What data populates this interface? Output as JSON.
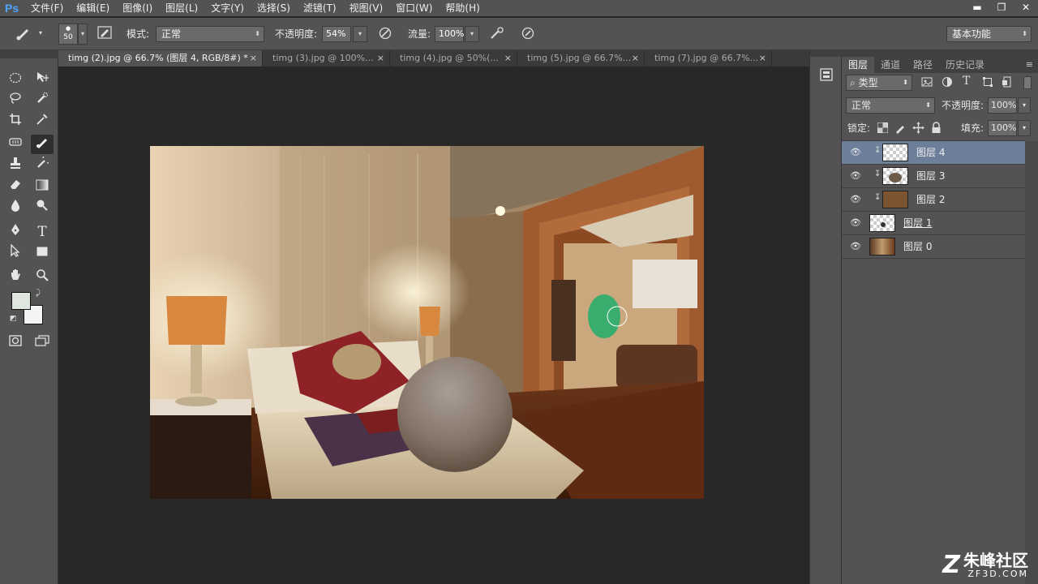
{
  "app": {
    "logo": "Ps"
  },
  "menu": [
    "文件(F)",
    "编辑(E)",
    "图像(I)",
    "图层(L)",
    "文字(Y)",
    "选择(S)",
    "滤镜(T)",
    "视图(V)",
    "窗口(W)",
    "帮助(H)"
  ],
  "window_controls": {
    "minimize": "▬",
    "restore": "❐",
    "close": "✕"
  },
  "options": {
    "brush_size": "50",
    "mode_label": "模式:",
    "mode_value": "正常",
    "opacity_label": "不透明度:",
    "opacity_value": "54%",
    "flow_label": "流量:",
    "flow_value": "100%",
    "workspace": "基本功能"
  },
  "tabs": [
    {
      "label": "timg (2).jpg @ 66.7% (图层 4, RGB/8#) *",
      "close": "×"
    },
    {
      "label": "timg (3).jpg @ 100%...",
      "close": "×"
    },
    {
      "label": "timg (4).jpg @ 50%(...",
      "close": "×"
    },
    {
      "label": "timg (5).jpg @ 66.7%...",
      "close": "×"
    },
    {
      "label": "timg (7).jpg @ 66.7%...",
      "close": "×"
    }
  ],
  "tools": {
    "type_glyph": "T",
    "fg_color": "#dfe6e0",
    "bg_color": "#f4f4f4"
  },
  "layers_panel": {
    "tabs": [
      "图层",
      "通道",
      "路径",
      "历史记录"
    ],
    "filter_label": "类型",
    "blend_mode": "正常",
    "opacity_label": "不透明度:",
    "opacity_value": "100%",
    "lock_label": "锁定:",
    "fill_label": "填充:",
    "fill_value": "100%",
    "layers": [
      {
        "name": "图层 4",
        "selected": true,
        "clipped": true
      },
      {
        "name": "图层 3",
        "selected": false,
        "clipped": true
      },
      {
        "name": "图层 2",
        "selected": false,
        "clipped": true
      },
      {
        "name": "图层 1",
        "selected": false,
        "clipped": false
      },
      {
        "name": "图层 0",
        "selected": false,
        "clipped": false
      }
    ]
  },
  "watermark": {
    "brand": "朱峰社区",
    "site": "ZF3D.COM"
  },
  "colors": {
    "chrome": "#535353",
    "canvas_bg": "#282828",
    "selected_layer": "#6d7f9b",
    "brush_stroke": "#1fae6b"
  }
}
